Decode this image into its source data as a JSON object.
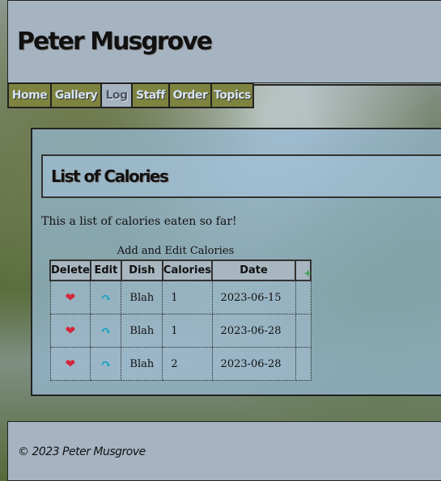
{
  "site": {
    "title": "Peter Musgrove"
  },
  "nav": [
    {
      "label": "Home"
    },
    {
      "label": "Gallery"
    },
    {
      "label": "Log"
    },
    {
      "label": "Staff"
    },
    {
      "label": "Order"
    },
    {
      "label": "Topics"
    }
  ],
  "nav_active": "Log",
  "page": {
    "title": "List of Calories",
    "intro": "This a list of calories eaten so far!"
  },
  "table": {
    "caption": "Add and Edit Calories",
    "headers": [
      "Delete",
      "Edit",
      "Dish",
      "Calories",
      "Date"
    ],
    "add_icon": "add-icon",
    "rows": [
      {
        "dish": "Blah",
        "calories": "1",
        "date": "2023-06-15"
      },
      {
        "dish": "Blah",
        "calories": "1",
        "date": "2023-06-28"
      },
      {
        "dish": "Blah",
        "calories": "2",
        "date": "2023-06-28"
      }
    ],
    "delete_icon": "broken-heart-icon",
    "edit_icon": "redo-arrow-icon"
  },
  "footer": {
    "text": "© 2023 Peter Musgrove"
  },
  "colors": {
    "nav_bg": "#7e8340",
    "nav_text": "#d6e4ef",
    "panel_bg": "#a6b4c2",
    "delete_icon": "#d3263a",
    "edit_icon": "#19a3c0",
    "add_icon": "#2e9e3e"
  }
}
